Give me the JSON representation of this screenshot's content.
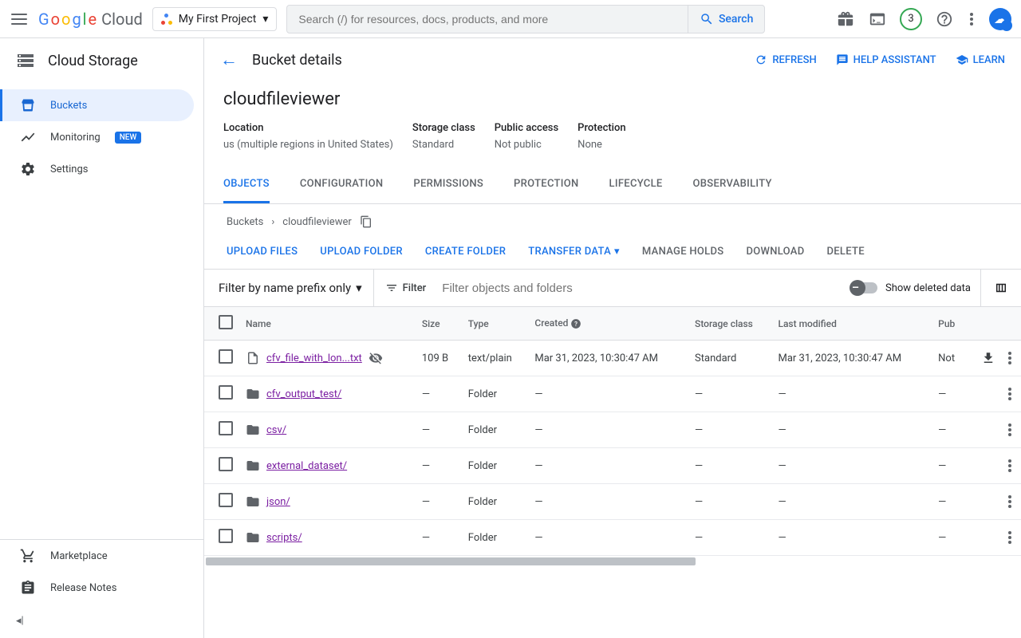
{
  "header": {
    "logo_cloud": "Cloud",
    "project": "My First Project",
    "search_placeholder": "Search (/) for resources, docs, products, and more",
    "search_button": "Search",
    "badge": "3"
  },
  "sidebar": {
    "title": "Cloud Storage",
    "items": [
      {
        "label": "Buckets",
        "active": true
      },
      {
        "label": "Monitoring",
        "badge": "NEW"
      },
      {
        "label": "Settings"
      }
    ],
    "footer": [
      {
        "label": "Marketplace"
      },
      {
        "label": "Release Notes"
      }
    ]
  },
  "page": {
    "title": "Bucket details",
    "actions": {
      "refresh": "REFRESH",
      "help": "HELP ASSISTANT",
      "learn": "LEARN"
    },
    "bucket_name": "cloudfileviewer",
    "info": [
      {
        "label": "Location",
        "value": "us (multiple regions in United States)"
      },
      {
        "label": "Storage class",
        "value": "Standard"
      },
      {
        "label": "Public access",
        "value": "Not public"
      },
      {
        "label": "Protection",
        "value": "None"
      }
    ],
    "tabs": [
      "OBJECTS",
      "CONFIGURATION",
      "PERMISSIONS",
      "PROTECTION",
      "LIFECYCLE",
      "OBSERVABILITY"
    ],
    "breadcrumb": {
      "root": "Buckets",
      "current": "cloudfileviewer"
    },
    "toolbar": {
      "upload_files": "UPLOAD FILES",
      "upload_folder": "UPLOAD FOLDER",
      "create_folder": "CREATE FOLDER",
      "transfer": "TRANSFER DATA",
      "manage_holds": "MANAGE HOLDS",
      "download": "DOWNLOAD",
      "delete": "DELETE"
    },
    "filter": {
      "mode": "Filter by name prefix only",
      "label": "Filter",
      "placeholder": "Filter objects and folders",
      "toggle_label": "Show deleted data"
    },
    "columns": [
      "Name",
      "Size",
      "Type",
      "Created",
      "Storage class",
      "Last modified",
      "Pub"
    ],
    "rows": [
      {
        "icon": "file",
        "name": "cfv_file_with_lon...txt",
        "size": "109 B",
        "type": "text/plain",
        "created": "Mar 31, 2023, 10:30:47 AM",
        "storage": "Standard",
        "modified": "Mar 31, 2023, 10:30:47 AM",
        "pub": "Not",
        "hidden_vis": true,
        "download": true
      },
      {
        "icon": "folder",
        "name": "cfv_output_test/",
        "size": "—",
        "type": "Folder",
        "created": "—",
        "storage": "—",
        "modified": "—",
        "pub": "—"
      },
      {
        "icon": "folder",
        "name": "csv/",
        "size": "—",
        "type": "Folder",
        "created": "—",
        "storage": "—",
        "modified": "—",
        "pub": "—"
      },
      {
        "icon": "folder",
        "name": "external_dataset/",
        "size": "—",
        "type": "Folder",
        "created": "—",
        "storage": "—",
        "modified": "—",
        "pub": "—"
      },
      {
        "icon": "folder",
        "name": "json/",
        "size": "—",
        "type": "Folder",
        "created": "—",
        "storage": "—",
        "modified": "—",
        "pub": "—"
      },
      {
        "icon": "folder",
        "name": "scripts/",
        "size": "—",
        "type": "Folder",
        "created": "—",
        "storage": "—",
        "modified": "—",
        "pub": "—"
      }
    ]
  }
}
